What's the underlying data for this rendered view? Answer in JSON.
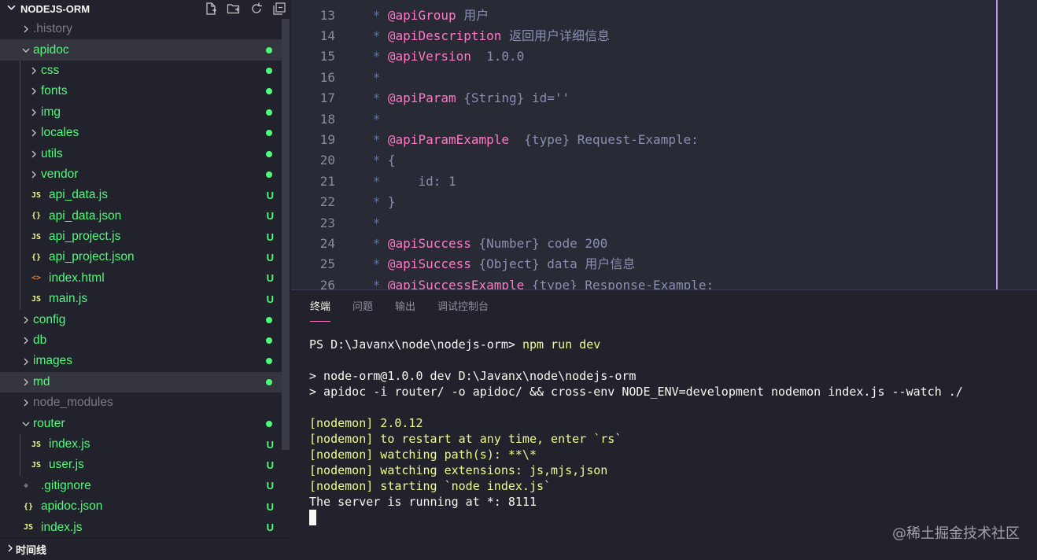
{
  "explorer": {
    "title": "NODEJS-ORM",
    "actions": [
      {
        "name": "new-file-icon"
      },
      {
        "name": "new-folder-icon"
      },
      {
        "name": "refresh-icon"
      },
      {
        "name": "collapse-all-icon"
      }
    ]
  },
  "tree": [
    {
      "label": ".history",
      "indent": 0,
      "type": "folder",
      "expanded": false,
      "color": "#7a7c88",
      "status": "",
      "status_color": ""
    },
    {
      "label": "apidoc",
      "indent": 0,
      "type": "folder",
      "expanded": true,
      "color": "#50fa7b",
      "status": "dot",
      "status_color": "#50fa7b",
      "selected": true
    },
    {
      "label": "css",
      "indent": 1,
      "type": "folder",
      "expanded": false,
      "color": "#50fa7b",
      "status": "dot",
      "status_color": "#50fa7b"
    },
    {
      "label": "fonts",
      "indent": 1,
      "type": "folder",
      "expanded": false,
      "color": "#50fa7b",
      "status": "dot",
      "status_color": "#50fa7b"
    },
    {
      "label": "img",
      "indent": 1,
      "type": "folder",
      "expanded": false,
      "color": "#50fa7b",
      "status": "dot",
      "status_color": "#50fa7b"
    },
    {
      "label": "locales",
      "indent": 1,
      "type": "folder",
      "expanded": false,
      "color": "#50fa7b",
      "status": "dot",
      "status_color": "#50fa7b"
    },
    {
      "label": "utils",
      "indent": 1,
      "type": "folder",
      "expanded": false,
      "color": "#50fa7b",
      "status": "dot",
      "status_color": "#50fa7b"
    },
    {
      "label": "vendor",
      "indent": 1,
      "type": "folder",
      "expanded": false,
      "color": "#50fa7b",
      "status": "dot",
      "status_color": "#50fa7b"
    },
    {
      "label": "api_data.js",
      "indent": 1,
      "type": "file",
      "icon": "JS",
      "icon_color": "#f1fa8c",
      "color": "#50fa7b",
      "status": "U",
      "status_color": "#50fa7b"
    },
    {
      "label": "api_data.json",
      "indent": 1,
      "type": "file",
      "icon": "{}",
      "icon_color": "#f1fa8c",
      "color": "#50fa7b",
      "status": "U",
      "status_color": "#50fa7b"
    },
    {
      "label": "api_project.js",
      "indent": 1,
      "type": "file",
      "icon": "JS",
      "icon_color": "#f1fa8c",
      "color": "#50fa7b",
      "status": "U",
      "status_color": "#50fa7b"
    },
    {
      "label": "api_project.json",
      "indent": 1,
      "type": "file",
      "icon": "{}",
      "icon_color": "#f1fa8c",
      "color": "#50fa7b",
      "status": "U",
      "status_color": "#50fa7b"
    },
    {
      "label": "index.html",
      "indent": 1,
      "type": "file",
      "icon": "<>",
      "icon_color": "#e37933",
      "color": "#50fa7b",
      "status": "U",
      "status_color": "#50fa7b"
    },
    {
      "label": "main.js",
      "indent": 1,
      "type": "file",
      "icon": "JS",
      "icon_color": "#f1fa8c",
      "color": "#50fa7b",
      "status": "U",
      "status_color": "#50fa7b"
    },
    {
      "label": "config",
      "indent": 0,
      "type": "folder",
      "expanded": false,
      "color": "#50fa7b",
      "status": "dot",
      "status_color": "#50fa7b"
    },
    {
      "label": "db",
      "indent": 0,
      "type": "folder",
      "expanded": false,
      "color": "#50fa7b",
      "status": "dot",
      "status_color": "#50fa7b"
    },
    {
      "label": "images",
      "indent": 0,
      "type": "folder",
      "expanded": false,
      "color": "#50fa7b",
      "status": "dot",
      "status_color": "#50fa7b"
    },
    {
      "label": "md",
      "indent": 0,
      "type": "folder",
      "expanded": false,
      "color": "#50fa7b",
      "status": "dot",
      "status_color": "#50fa7b",
      "selected": true
    },
    {
      "label": "node_modules",
      "indent": 0,
      "type": "folder",
      "expanded": false,
      "color": "#7a7c88",
      "status": "",
      "status_color": ""
    },
    {
      "label": "router",
      "indent": 0,
      "type": "folder",
      "expanded": true,
      "color": "#50fa7b",
      "status": "dot",
      "status_color": "#50fa7b"
    },
    {
      "label": "index.js",
      "indent": 1,
      "type": "file",
      "icon": "JS",
      "icon_color": "#f1fa8c",
      "color": "#50fa7b",
      "status": "U",
      "status_color": "#50fa7b"
    },
    {
      "label": "user.js",
      "indent": 1,
      "type": "file",
      "icon": "JS",
      "icon_color": "#f1fa8c",
      "color": "#50fa7b",
      "status": "U",
      "status_color": "#50fa7b"
    },
    {
      "label": ".gitignore",
      "indent": 0,
      "type": "file",
      "icon": "◆",
      "icon_color": "#6c6f85",
      "color": "#50fa7b",
      "status": "U",
      "status_color": "#50fa7b"
    },
    {
      "label": "apidoc.json",
      "indent": 0,
      "type": "file",
      "icon": "{}",
      "icon_color": "#f1fa8c",
      "color": "#50fa7b",
      "status": "U",
      "status_color": "#50fa7b"
    },
    {
      "label": "index.js",
      "indent": 0,
      "type": "file",
      "icon": "JS",
      "icon_color": "#f1fa8c",
      "color": "#50fa7b",
      "status": "U",
      "status_color": "#50fa7b"
    }
  ],
  "timeline": {
    "label": "时间线"
  },
  "editor": {
    "lines": [
      {
        "num": "13",
        "segs": [
          {
            "t": " * ",
            "c": "c-com"
          },
          {
            "t": "@apiGroup",
            "c": "c-tag"
          },
          {
            "t": " 用户",
            "c": "c-txt"
          }
        ]
      },
      {
        "num": "14",
        "segs": [
          {
            "t": " * ",
            "c": "c-com"
          },
          {
            "t": "@apiDescription",
            "c": "c-tag"
          },
          {
            "t": " 返回用户详细信息",
            "c": "c-txt"
          }
        ]
      },
      {
        "num": "15",
        "segs": [
          {
            "t": " * ",
            "c": "c-com"
          },
          {
            "t": "@apiVersion",
            "c": "c-tag"
          },
          {
            "t": "  1.0.0",
            "c": "c-txt"
          }
        ]
      },
      {
        "num": "16",
        "segs": [
          {
            "t": " *",
            "c": "c-com"
          }
        ]
      },
      {
        "num": "17",
        "segs": [
          {
            "t": " * ",
            "c": "c-com"
          },
          {
            "t": "@apiParam",
            "c": "c-tag"
          },
          {
            "t": " {String} id=''",
            "c": "c-txt"
          }
        ]
      },
      {
        "num": "18",
        "segs": [
          {
            "t": " *",
            "c": "c-com"
          }
        ]
      },
      {
        "num": "19",
        "segs": [
          {
            "t": " * ",
            "c": "c-com"
          },
          {
            "t": "@apiParamExample",
            "c": "c-tag"
          },
          {
            "t": "  {type} Request-Example:",
            "c": "c-txt"
          }
        ]
      },
      {
        "num": "20",
        "segs": [
          {
            "t": " * ",
            "c": "c-com"
          },
          {
            "t": "{",
            "c": "c-txt"
          }
        ]
      },
      {
        "num": "21",
        "segs": [
          {
            "t": " *     ",
            "c": "c-com"
          },
          {
            "t": "id: 1",
            "c": "c-txt"
          }
        ]
      },
      {
        "num": "22",
        "segs": [
          {
            "t": " * ",
            "c": "c-com"
          },
          {
            "t": "}",
            "c": "c-txt"
          }
        ]
      },
      {
        "num": "23",
        "segs": [
          {
            "t": " *",
            "c": "c-com"
          }
        ]
      },
      {
        "num": "24",
        "segs": [
          {
            "t": " * ",
            "c": "c-com"
          },
          {
            "t": "@apiSuccess",
            "c": "c-tag"
          },
          {
            "t": " {Number} code 200",
            "c": "c-txt"
          }
        ]
      },
      {
        "num": "25",
        "segs": [
          {
            "t": " * ",
            "c": "c-com"
          },
          {
            "t": "@apiSuccess",
            "c": "c-tag"
          },
          {
            "t": " {Object} data 用户信息",
            "c": "c-txt"
          }
        ]
      },
      {
        "num": "26",
        "segs": [
          {
            "t": " * ",
            "c": "c-com"
          },
          {
            "t": "@apiSuccessExample",
            "c": "c-tag"
          },
          {
            "t": " {type} Response-Example:",
            "c": "c-txt"
          }
        ]
      }
    ]
  },
  "panel": {
    "tabs": [
      {
        "label": "终端",
        "active": true
      },
      {
        "label": "问题",
        "active": false
      },
      {
        "label": "输出",
        "active": false
      },
      {
        "label": "调试控制台",
        "active": false
      }
    ],
    "terminal_lines": [
      {
        "segs": [
          {
            "t": "PS D:\\Javanx\\node\\nodejs-orm> "
          },
          {
            "t": "npm run dev",
            "c": "t-yellow"
          }
        ]
      },
      {
        "segs": [
          {
            "t": ""
          }
        ]
      },
      {
        "segs": [
          {
            "t": "> node-orm@1.0.0 dev D:\\Javanx\\node\\nodejs-orm"
          }
        ]
      },
      {
        "segs": [
          {
            "t": "> apidoc -i router/ -o apidoc/ && cross-env NODE_ENV=development nodemon index.js --watch ./"
          }
        ]
      },
      {
        "segs": [
          {
            "t": ""
          }
        ]
      },
      {
        "segs": [
          {
            "t": "[nodemon] 2.0.12",
            "c": "t-yellow"
          }
        ]
      },
      {
        "segs": [
          {
            "t": "[nodemon] to restart at any time, enter `rs`",
            "c": "t-yellow"
          }
        ]
      },
      {
        "segs": [
          {
            "t": "[nodemon] watching path(s): **\\*",
            "c": "t-yellow"
          }
        ]
      },
      {
        "segs": [
          {
            "t": "[nodemon] watching extensions: js,mjs,json",
            "c": "t-yellow"
          }
        ]
      },
      {
        "segs": [
          {
            "t": "[nodemon] starting `node index.js`",
            "c": "t-yellow"
          }
        ]
      },
      {
        "segs": [
          {
            "t": "The server is running at *: 8111"
          }
        ]
      }
    ]
  },
  "watermark": "@稀土掘金技术社区"
}
